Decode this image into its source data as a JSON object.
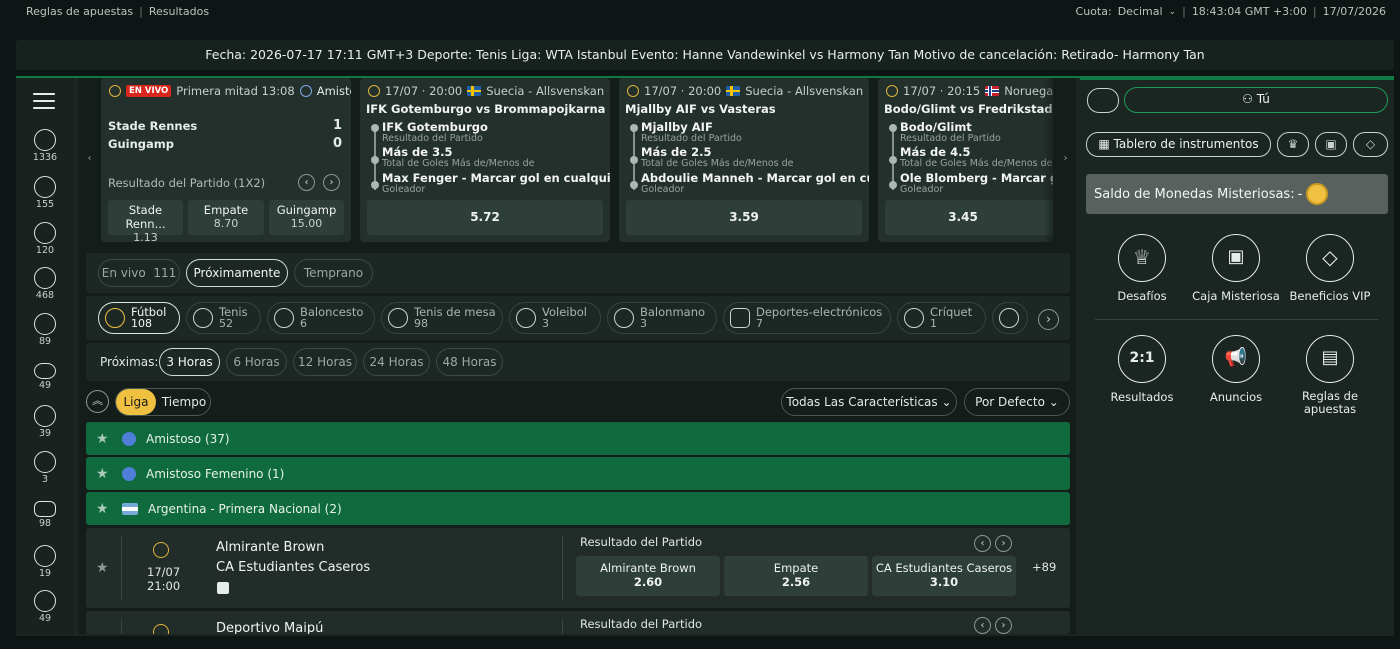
{
  "topbar": {
    "rules": "Reglas de apuestas",
    "results": "Resultados",
    "odds_label": "Cuota:",
    "odds_value": "Decimal",
    "time": "18:43:04 GMT +3:00",
    "date": "17/07/2026"
  },
  "ticker": "Fecha: 2026-07-17 17:11 GMT+3 Deporte: Tenis Liga: WTA Istanbul Evento: Hanne Vandewinkel vs Harmony Tan Motivo de cancelación: Retirado- Harmony Tan",
  "sidebar": [
    {
      "icon": "football-icon",
      "count": "1336"
    },
    {
      "icon": "tennis-icon",
      "count": "155"
    },
    {
      "icon": "basketball-icon",
      "count": "120"
    },
    {
      "icon": "table-tennis-icon",
      "count": "468"
    },
    {
      "icon": "volleyball-icon",
      "count": "89"
    },
    {
      "icon": "rugby-icon",
      "count": "49"
    },
    {
      "icon": "football-icon",
      "count": "39"
    },
    {
      "icon": "handball-icon",
      "count": "3"
    },
    {
      "icon": "esports-icon",
      "count": "98"
    },
    {
      "icon": "cricket-icon",
      "count": "19"
    },
    {
      "icon": "baseball-icon",
      "count": "49"
    }
  ],
  "featured": {
    "live_card": {
      "live_badge": "EN VIVO",
      "period": "Primera mitad 13:08",
      "competition": "Amistoso",
      "team1": "Stade Rennes",
      "score1": "1",
      "team2": "Guingamp",
      "score2": "0",
      "market": "Resultado del Partido (1X2)",
      "odds": [
        {
          "label": "Stade Renn...",
          "value": "1.13"
        },
        {
          "label": "Empate",
          "value": "8.70"
        },
        {
          "label": "Guingamp",
          "value": "15.00"
        }
      ]
    },
    "cards": [
      {
        "datetime": "17/07 · 20:00",
        "league": "Suecia - Allsvenskan",
        "title": "IFK Gotemburgo vs Brommapojkarna",
        "leg1": "IFK Gotemburgo",
        "leg1_market": "Resultado del Partido",
        "leg2": "Más de 3.5",
        "leg2_market": "Total de Goles Más de/Menos de",
        "leg3": "Max Fenger - Marcar gol en cualquier ...",
        "leg3_market": "Goleador",
        "odds": "5.72"
      },
      {
        "datetime": "17/07 · 20:00",
        "league": "Suecia - Allsvenskan",
        "title": "Mjallby AIF vs Vasteras",
        "leg1": "Mjallby AIF",
        "leg1_market": "Resultado del Partido",
        "leg2": "Más de 2.5",
        "leg2_market": "Total de Goles Más de/Menos de",
        "leg3": "Abdoulie Manneh - Marcar gol en cual...",
        "leg3_market": "Goleador",
        "odds": "3.59"
      },
      {
        "datetime": "17/07 · 20:15",
        "league": "Noruega - E",
        "title": "Bodo/Glimt vs Fredrikstad",
        "leg1": "Bodo/Glimt",
        "leg1_market": "Resultado del Partido",
        "leg2": "Más de 4.5",
        "leg2_market": "Total de Goles Más de/Menos de",
        "leg3": "Ole Blomberg - Marcar gol e",
        "leg3_market": "Goleador",
        "odds": "3.45"
      }
    ]
  },
  "mode_tabs": [
    {
      "label": "En vivo",
      "count": "111"
    },
    {
      "label": "Próximamente"
    },
    {
      "label": "Temprano"
    }
  ],
  "sports": [
    {
      "name": "Fútbol",
      "count": "108"
    },
    {
      "name": "Tenis",
      "count": "52"
    },
    {
      "name": "Baloncesto",
      "count": "6"
    },
    {
      "name": "Tenis de mesa",
      "count": "98"
    },
    {
      "name": "Voleibol",
      "count": "3"
    },
    {
      "name": "Balonmano",
      "count": "3"
    },
    {
      "name": "Deportes-electrónicos",
      "count": "7"
    },
    {
      "name": "Críquet",
      "count": "1"
    }
  ],
  "hours": {
    "label": "Próximas:",
    "options": [
      "3 Horas",
      "6 Horas",
      "12 Horas",
      "24 Horas",
      "48 Horas"
    ]
  },
  "view": {
    "liga": "Liga",
    "tiempo": "Tiempo",
    "features": "Todas Las Características",
    "sort": "Por Defecto"
  },
  "leagues": [
    {
      "name": "Amistoso (37)"
    },
    {
      "name": "Amistoso Femenino (1)"
    },
    {
      "name": "Argentina - Primera Nacional (2)"
    }
  ],
  "events": [
    {
      "date": "17/07",
      "time": "21:00",
      "home": "Almirante Brown",
      "away": "CA Estudiantes Caseros",
      "market": "Resultado del Partido",
      "odds": [
        {
          "label": "Almirante Brown",
          "value": "2.60"
        },
        {
          "label": "Empate",
          "value": "2.56"
        },
        {
          "label": "CA Estudiantes Caseros",
          "value": "3.10"
        }
      ],
      "more": "+89"
    },
    {
      "home": "Deportivo Maipú",
      "market": "Resultado del Partido"
    }
  ],
  "right_panel": {
    "user": "Tú",
    "dashboard": "Tablero de instrumentos",
    "mystery": "Saldo de Monedas Misteriosas:",
    "mystery_value": "-",
    "tiles": [
      {
        "label": "Desafíos",
        "icon": "trophy-icon"
      },
      {
        "label": "Caja Misteriosa",
        "icon": "mystery-box-icon"
      },
      {
        "label": "Beneficios VIP",
        "icon": "diamond-icon"
      },
      {
        "label": "Resultados",
        "icon": "results-icon",
        "glyph": "2:1"
      },
      {
        "label": "Anuncios",
        "icon": "megaphone-icon"
      },
      {
        "label": "Reglas de apuestas",
        "icon": "rules-scroll-icon"
      }
    ]
  },
  "colors": {
    "accent_green": "#0f6b3d",
    "live_red": "#d9261c",
    "gold": "#f0c040"
  }
}
